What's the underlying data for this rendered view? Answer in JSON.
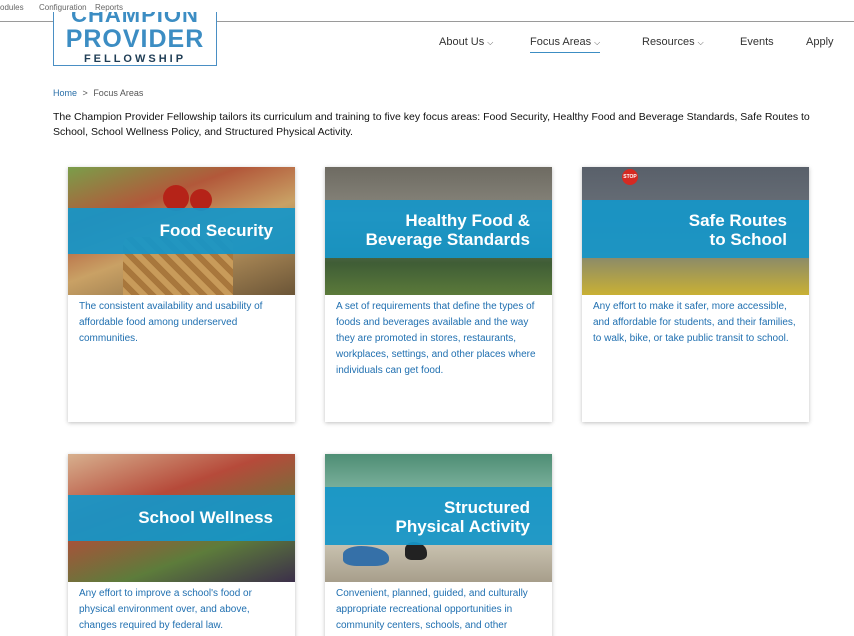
{
  "admin_bar": {
    "items": [
      "odules",
      "Configuration",
      "Reports"
    ]
  },
  "logo": {
    "line1": "CHAMPION",
    "line2": "PROVIDER",
    "line3": "FELLOWSHIP"
  },
  "nav": {
    "items": [
      {
        "label": "About Us",
        "has_dropdown": true
      },
      {
        "label": "Focus Areas",
        "has_dropdown": true,
        "active": true
      },
      {
        "label": "Resources",
        "has_dropdown": true
      },
      {
        "label": "Events",
        "has_dropdown": false
      },
      {
        "label": "Apply",
        "has_dropdown": false
      }
    ],
    "chevron": "⌵"
  },
  "breadcrumb": {
    "home": "Home",
    "separator": ">",
    "current": "Focus Areas"
  },
  "intro": "The Champion Provider Fellowship tailors its curriculum and training to five key focus areas: Food Security, Healthy Food and Beverage Standards, Safe Routes to School, School Wellness Policy, and Structured Physical Activity.",
  "cards": [
    {
      "title_line1": "Food Security",
      "title_line2": "",
      "description": "The consistent availability and usability of affordable food among underserved communities."
    },
    {
      "title_line1": "Healthy Food &",
      "title_line2": "Beverage Standards",
      "description": "A set of requirements that define the types of foods and beverages available and the way they are promoted in stores, restaurants, workplaces, settings, and other places where individuals can get food."
    },
    {
      "title_line1": "Safe Routes",
      "title_line2": "to School",
      "description": "Any effort to make it safer, more accessible, and affordable for students, and their families, to walk, bike, or take public transit to school."
    },
    {
      "title_line1": "School Wellness",
      "title_line2": "",
      "description": "Any effort to improve a school's food or physical environment over, and above, changes required by federal law."
    },
    {
      "title_line1": "Structured",
      "title_line2": "Physical Activity",
      "description": "Convenient, planned, guided, and culturally appropriate recreational opportunities in community centers, schools, and other settings as well."
    }
  ],
  "image_text": {
    "stop_sign": "STOP"
  },
  "colors": {
    "brand_blue": "#3c8dc3",
    "band_blue": "#1596c8",
    "link_blue": "#1f6fb0"
  }
}
